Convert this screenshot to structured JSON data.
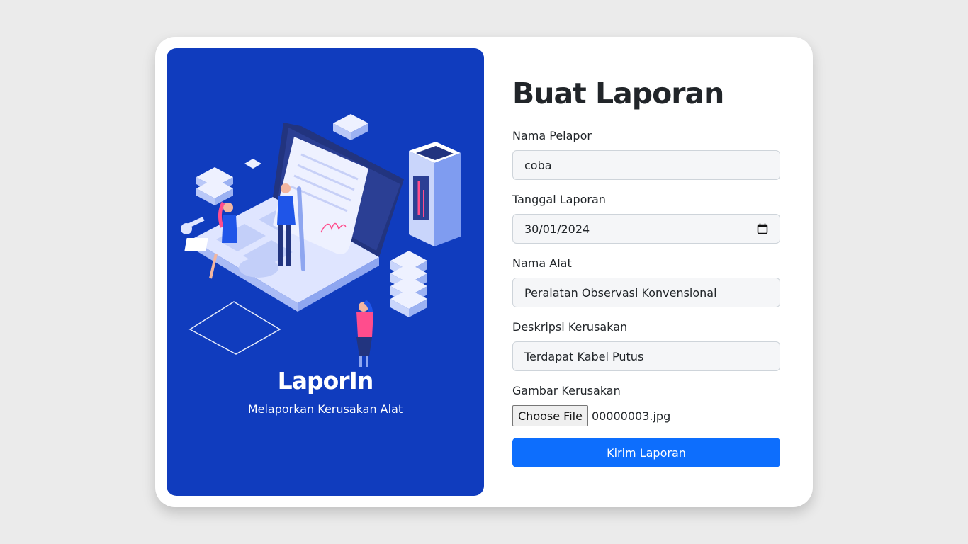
{
  "brand": {
    "name": "LaporIn",
    "tagline": "Melaporkan Kerusakan Alat"
  },
  "form": {
    "title": "Buat Laporan",
    "fields": {
      "nama_pelapor": {
        "label": "Nama Pelapor",
        "value": "coba"
      },
      "tanggal_laporan": {
        "label": "Tanggal Laporan",
        "value": "30/01/2024"
      },
      "nama_alat": {
        "label": "Nama Alat",
        "value": "Peralatan Observasi Konvensional"
      },
      "deskripsi_kerusakan": {
        "label": "Deskripsi Kerusakan",
        "value": "Terdapat Kabel Putus"
      },
      "gambar_kerusakan": {
        "label": "Gambar Kerusakan",
        "button": "Choose File",
        "file_name": "00000003.jpg"
      }
    },
    "submit_label": "Kirim Laporan"
  },
  "colors": {
    "page_background": "#ebebeb",
    "panel_blue": "#103cbe",
    "button_blue": "#0d6efd",
    "input_background": "#f5f6f8"
  },
  "icons": {
    "date_picker": "calendar-icon",
    "illustration": "report-signing-illustration"
  }
}
